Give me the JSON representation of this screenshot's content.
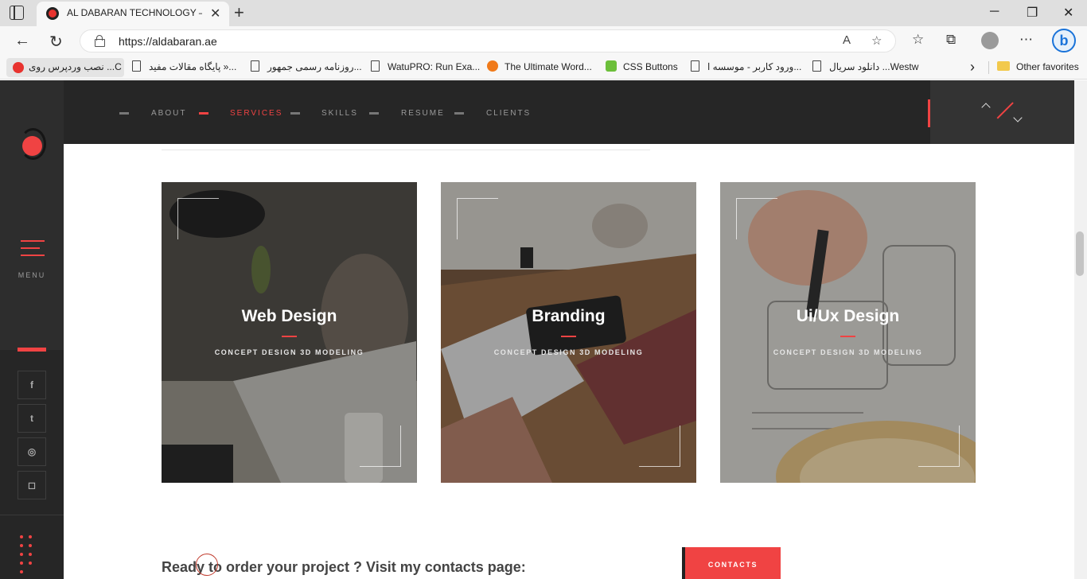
{
  "browser": {
    "tab_title": "AL DABARAN TECHNOLOGY – Di",
    "close_glyph": "✕",
    "new_tab_glyph": "+",
    "url": "https://aldabaran.ae",
    "window_controls": {
      "minimize": "─",
      "maximize": "❐",
      "close": "✕"
    },
    "nav": {
      "back": "←",
      "reload": "↻"
    },
    "url_icons": {
      "read_aloud": "A",
      "add_favorite": "☆"
    },
    "toolbar_icons": {
      "favorites": "☆",
      "collections": "⧉",
      "more": "⋯",
      "bing": "b"
    },
    "favorites": [
      {
        "label": "نصب وردپرس روی ...C",
        "icon": "wp-red-icon"
      },
      {
        "label": "پایگاه مقالات مفید »...",
        "icon": "doc-icon"
      },
      {
        "label": "روزنامه رسمی جمهور...",
        "icon": "doc-icon"
      },
      {
        "label": "WatuPRO: Run Exa...",
        "icon": "doc-icon"
      },
      {
        "label": "The Ultimate Word...",
        "icon": "orange-icon"
      },
      {
        "label": "CSS Buttons",
        "icon": "green-icon"
      },
      {
        "label": "ورود کاربر - موسسه ا...",
        "icon": "doc-icon"
      },
      {
        "label": "دانلود سریال ...Westw",
        "icon": "doc-icon"
      }
    ],
    "favorites_overflow": "›",
    "other_favorites": "Other favorites"
  },
  "sidebar": {
    "menu_label": "MENU",
    "social": [
      {
        "icon": "facebook-icon",
        "glyph": "f"
      },
      {
        "icon": "twitter-icon",
        "glyph": "t"
      },
      {
        "icon": "dribbble-icon",
        "glyph": "◎"
      },
      {
        "icon": "instagram-icon",
        "glyph": "◻"
      }
    ]
  },
  "topnav": {
    "items": [
      {
        "label": "ABOUT",
        "active": false
      },
      {
        "label": "SERVICES",
        "active": true
      },
      {
        "label": "SKILLS",
        "active": false
      },
      {
        "label": "RESUME",
        "active": false
      },
      {
        "label": "CLIENTS",
        "active": false
      }
    ]
  },
  "services": [
    {
      "title": "Web Design",
      "subtitle": "CONCEPT  DESIGN  3D MODELING"
    },
    {
      "title": "Branding",
      "subtitle": "CONCEPT  DESIGN  3D MODELING"
    },
    {
      "title": "Ui/Ux Design",
      "subtitle": "CONCEPT  DESIGN  3D MODELING"
    }
  ],
  "cta": {
    "text": "Ready to order your project ? Visit my contacts page:",
    "button": "CONTACTS"
  },
  "colors": {
    "accent": "#f04343",
    "dark": "#262626",
    "sidebar_upper": "#2d2d2d"
  }
}
